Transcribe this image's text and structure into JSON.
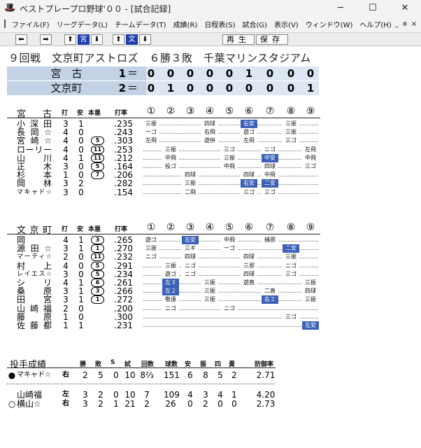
{
  "window": {
    "title": "ベストプレープロ野球'００ - [試合記録]",
    "minimize": "─",
    "maximize": "☐",
    "close": "✕",
    "app_icon": "baseball-cap-icon"
  },
  "menu": [
    "ファイル(F)",
    "リーグデータ(L)",
    "チームデータ(T)",
    "成績(R)",
    "日程表(S)",
    "試合(G)",
    "表示(V)",
    "ウィンドウ(W)",
    "ヘルプ(H)"
  ],
  "mdi": [
    "_",
    "ᴙ",
    "×"
  ],
  "toolbar": {
    "left": "⬅",
    "right": "➡",
    "up1": "⬆",
    "team1": "宮",
    "down1": "⬇",
    "up2": "⬆",
    "team2": "文",
    "down2": "⬇",
    "play": "再生",
    "save": "保存"
  },
  "game_info": "９回戦　文京町アストロズ　６勝３敗　千葉マリンスタジアム",
  "scoreboard": [
    {
      "team": "宮　古",
      "runs": "1",
      "eq": "＝",
      "innings": [
        "0",
        "0",
        "0",
        "0",
        "0",
        "1",
        "0",
        "0",
        "0"
      ]
    },
    {
      "team": "文京町",
      "runs": "2",
      "eq": "＝",
      "innings": [
        "0",
        "1",
        "0",
        "0",
        "0",
        "0",
        "0",
        "0",
        "1"
      ]
    }
  ],
  "headers": {
    "ab": "打",
    "h": "安",
    "hr": "本塁",
    "avg": "打率",
    "innings": [
      "①",
      "②",
      "③",
      "④",
      "⑤",
      "⑥",
      "⑦",
      "⑧",
      "⑨"
    ]
  },
  "teams": [
    {
      "name": "宮　古",
      "players": [
        {
          "name": "小深田",
          "ab": "3",
          "h": "1",
          "hr": "",
          "avg": ".235",
          "cells": [
            {
              "i": 1,
              "t": "三振"
            },
            {
              "i": 4,
              "t": "四球"
            },
            {
              "i": 6,
              "t": "右安",
              "hi": true
            },
            {
              "i": 8,
              "t": "三振"
            }
          ]
        },
        {
          "name": "長岡☆",
          "ab": "4",
          "h": "0",
          "hr": "",
          "avg": ".243",
          "cells": [
            {
              "i": 1,
              "t": "一ゴ"
            },
            {
              "i": 4,
              "t": "右飛"
            },
            {
              "i": 6,
              "t": "遊ゴ"
            },
            {
              "i": 8,
              "t": "三振"
            }
          ]
        },
        {
          "name": "宮崎☆",
          "ab": "4",
          "h": "0",
          "hr": "5",
          "avg": ".303",
          "cells": [
            {
              "i": 1,
              "t": "左飛"
            },
            {
              "i": 4,
              "t": "遊併"
            },
            {
              "i": 6,
              "t": "左飛"
            },
            {
              "i": 8,
              "t": "三ゴ"
            }
          ]
        },
        {
          "name": "ローリー",
          "ab": "4",
          "h": "0",
          "hr": "11",
          "avg": ".253",
          "cells": [
            {
              "i": 2,
              "t": "三振"
            },
            {
              "i": 5,
              "t": "三ゴ"
            },
            {
              "i": 7,
              "t": "ニゴ"
            },
            {
              "i": 9,
              "t": "左飛"
            }
          ]
        },
        {
          "name": "山　川",
          "ab": "4",
          "h": "1",
          "hr": "11",
          "avg": ".212",
          "cells": [
            {
              "i": 2,
              "t": "中飛"
            },
            {
              "i": 5,
              "t": "三振"
            },
            {
              "i": 7,
              "t": "中安",
              "hi": true
            },
            {
              "i": 9,
              "t": "中飛"
            }
          ]
        },
        {
          "name": "正　木",
          "ab": "3",
          "h": "0",
          "hr": "5",
          "avg": ".164",
          "cells": [
            {
              "i": 2,
              "t": "投ゴ"
            },
            {
              "i": 5,
              "t": "中飛"
            },
            {
              "i": 7,
              "t": "四球"
            },
            {
              "i": 9,
              "t": "三ゴ"
            }
          ]
        },
        {
          "name": "杉　本",
          "ab": "1",
          "h": "0",
          "hr": "7",
          "avg": ".206",
          "cells": [
            {
              "i": 3,
              "t": "四球"
            },
            {
              "i": 6,
              "t": "四球"
            },
            {
              "i": 7,
              "t": "中飛"
            }
          ]
        },
        {
          "name": "岡　林",
          "ab": "3",
          "h": "2",
          "hr": "",
          "avg": ".282",
          "cells": [
            {
              "i": 3,
              "t": "三振"
            },
            {
              "i": 6,
              "t": "右安",
              "hi": true
            },
            {
              "i": 7,
              "t": "二安",
              "hi": true
            }
          ]
        },
        {
          "name": "マキャド☆",
          "small": true,
          "ab": "3",
          "h": "0",
          "hr": "",
          "avg": ".154",
          "cells": [
            {
              "i": 3,
              "t": "二飛"
            },
            {
              "i": 6,
              "t": "三ゴ"
            },
            {
              "i": 7,
              "t": "三ゴ"
            }
          ]
        }
      ]
    },
    {
      "name": "文京町",
      "players": [
        {
          "name": "岡",
          "ab": "4",
          "h": "1",
          "hr": "3",
          "avg": ".265",
          "cells": [
            {
              "i": 1,
              "t": "遊ゴ"
            },
            {
              "i": 3,
              "t": "左安",
              "hi": true
            },
            {
              "i": 5,
              "t": "中飛"
            },
            {
              "i": 7,
              "t": "捕邪"
            }
          ]
        },
        {
          "name": "源田☆",
          "ab": "3",
          "h": "1",
          "hr": "1",
          "avg": ".270",
          "cells": [
            {
              "i": 1,
              "t": "三振"
            },
            {
              "i": 3,
              "t": "三ギ"
            },
            {
              "i": 5,
              "t": "一ゴ"
            },
            {
              "i": 8,
              "t": "二安",
              "hi": true
            }
          ]
        },
        {
          "name": "マーティ☆",
          "small": true,
          "ab": "2",
          "h": "0",
          "hr": "11",
          "avg": ".232",
          "cells": [
            {
              "i": 1,
              "t": "ニゴ"
            },
            {
              "i": 3,
              "t": "四球"
            },
            {
              "i": 6,
              "t": "四球"
            },
            {
              "i": 8,
              "t": "三振"
            }
          ]
        },
        {
          "name": "村　上",
          "ab": "4",
          "h": "0",
          "hr": "5",
          "avg": ".291",
          "cells": [
            {
              "i": 2,
              "t": "三振"
            },
            {
              "i": 3,
              "t": "ニゴ"
            },
            {
              "i": 6,
              "t": "三邪"
            },
            {
              "i": 8,
              "t": "ニゴ"
            }
          ]
        },
        {
          "name": "レイエス☆",
          "small": true,
          "ab": "3",
          "h": "0",
          "hr": "5",
          "avg": ".234",
          "cells": [
            {
              "i": 2,
              "t": "遊ゴ"
            },
            {
              "i": 3,
              "t": "ニゴ"
            },
            {
              "i": 6,
              "t": "四球"
            },
            {
              "i": 8,
              "t": "三ゴ"
            }
          ]
        },
        {
          "name": "シ　リ",
          "ab": "4",
          "h": "1",
          "hr": "6",
          "avg": ".261",
          "cells": [
            {
              "i": 2,
              "t": "左３",
              "hi": true
            },
            {
              "i": 4,
              "t": "三振"
            },
            {
              "i": 6,
              "t": "遊直"
            },
            {
              "i": 9,
              "t": "三振"
            }
          ]
        },
        {
          "name": "桑　原",
          "ab": "3",
          "h": "1",
          "hr": "3",
          "avg": ".266",
          "cells": [
            {
              "i": 2,
              "t": "左２",
              "hi": true
            },
            {
              "i": 4,
              "t": "三振"
            },
            {
              "i": 7,
              "t": "二直"
            },
            {
              "i": 9,
              "t": "四球"
            }
          ]
        },
        {
          "name": "田　宮",
          "ab": "3",
          "h": "1",
          "hr": "1",
          "avg": ".272",
          "cells": [
            {
              "i": 2,
              "t": "敬遠"
            },
            {
              "i": 4,
              "t": "三振"
            },
            {
              "i": 7,
              "t": "右２",
              "hi": true
            },
            {
              "i": 9,
              "t": "三振"
            }
          ]
        },
        {
          "name": "山崎福",
          "ab": "2",
          "h": "0",
          "hr": "",
          "avg": ".200",
          "cells": [
            {
              "i": 2,
              "t": "ニゴ"
            },
            {
              "i": 5,
              "t": "ニゴ"
            }
          ]
        },
        {
          "name": "藤　原",
          "ab": "1",
          "h": "0",
          "hr": "",
          "avg": ".300",
          "cells": [
            {
              "i": 8,
              "t": "三ゴ"
            }
          ]
        },
        {
          "name": "佐藤都",
          "ab": "1",
          "h": "1",
          "hr": "",
          "avg": ".231",
          "cells": [
            {
              "i": 9,
              "t": "左安",
              "hi": true
            }
          ]
        }
      ]
    }
  ],
  "pitching": {
    "title": "投手成績",
    "headers": [
      "勝",
      "敗",
      "S",
      "試",
      "回数",
      "球数",
      "安",
      "振",
      "四",
      "責",
      "防御率"
    ],
    "pitchers": [
      {
        "mark": "●",
        "name": "マキャド☆",
        "hand": "右",
        "stats": [
          "2",
          "5",
          "0",
          "10",
          "8⅔",
          "151",
          "6",
          "8",
          "5",
          "2",
          "2.71"
        ]
      },
      {
        "mark": "",
        "name": "山崎福",
        "hand": "左",
        "stats": [
          "3",
          "2",
          "0",
          "10",
          "7",
          "109",
          "4",
          "3",
          "4",
          "1",
          "4.20"
        ]
      },
      {
        "mark": "○",
        "name": "横山☆",
        "hand": "右",
        "stats": [
          "3",
          "2",
          "1",
          "21",
          "2",
          "26",
          "0",
          "2",
          "0",
          "0",
          "2.73"
        ]
      }
    ]
  }
}
